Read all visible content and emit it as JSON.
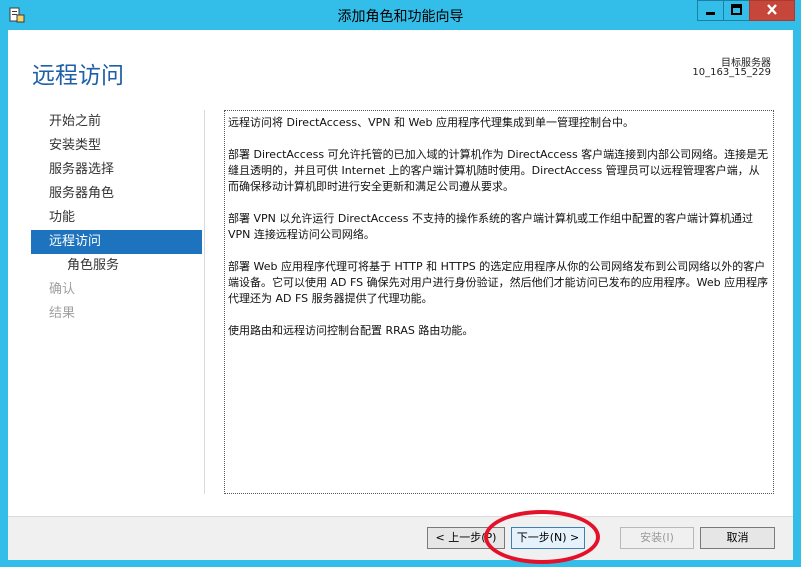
{
  "window": {
    "title": "添加角色和功能向导"
  },
  "header": {
    "page_title": "远程访问",
    "destination_label": "目标服务器",
    "destination_value": "10_163_15_229"
  },
  "nav": {
    "items": [
      {
        "label": "开始之前",
        "state": "normal"
      },
      {
        "label": "安装类型",
        "state": "normal"
      },
      {
        "label": "服务器选择",
        "state": "normal"
      },
      {
        "label": "服务器角色",
        "state": "normal"
      },
      {
        "label": "功能",
        "state": "normal"
      },
      {
        "label": "远程访问",
        "state": "active"
      },
      {
        "label": "角色服务",
        "state": "sub"
      },
      {
        "label": "确认",
        "state": "disabled"
      },
      {
        "label": "结果",
        "state": "disabled"
      }
    ]
  },
  "description": {
    "p1": "远程访问将 DirectAccess、VPN 和 Web 应用程序代理集成到单一管理控制台中。",
    "p2": "部署 DirectAccess 可允许托管的已加入域的计算机作为 DirectAccess 客户端连接到内部公司网络。连接是无缝且透明的，并且可供 Internet 上的客户端计算机随时使用。DirectAccess 管理员可以远程管理客户端，从而确保移动计算机即时进行安全更新和满足公司遵从要求。",
    "p3": "部署 VPN 以允许运行 DirectAccess 不支持的操作系统的客户端计算机或工作组中配置的客户端计算机通过 VPN 连接远程访问公司网络。",
    "p4": "部署 Web 应用程序代理可将基于 HTTP 和 HTTPS 的选定应用程序从你的公司网络发布到公司网络以外的客户端设备。它可以使用 AD FS 确保先对用户进行身份验证，然后他们才能访问已发布的应用程序。Web 应用程序代理还为 AD FS 服务器提供了代理功能。",
    "p5": "使用路由和远程访问控制台配置 RRAS 路由功能。"
  },
  "footer": {
    "prev_label": "< 上一步(P)",
    "next_label": "下一步(N) >",
    "install_label": "安装(I)",
    "cancel_label": "取消"
  },
  "colors": {
    "titlebar": "#33bde9",
    "accent": "#1d73bd",
    "title_text": "#1e5fa8",
    "annotation": "#e3122a"
  },
  "icons": {
    "app": "server-manager-icon",
    "minimize": "minimize-icon",
    "maximize": "maximize-icon",
    "close": "close-icon"
  }
}
